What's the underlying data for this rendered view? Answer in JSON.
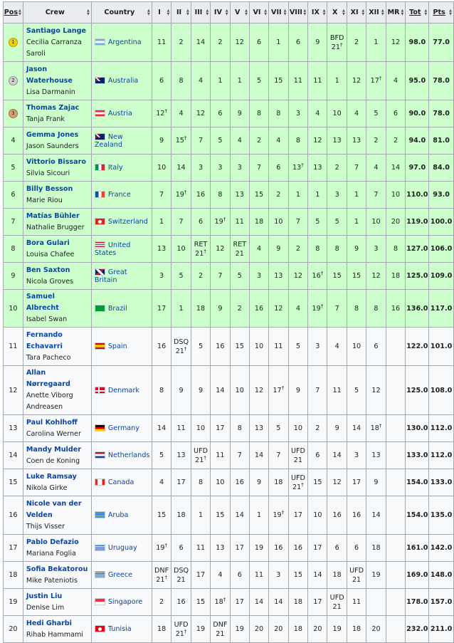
{
  "headers": {
    "pos": "Pos",
    "crew": "Crew",
    "country": "Country",
    "races": [
      "I",
      "II",
      "III",
      "IV",
      "V",
      "VI",
      "VII",
      "VIII",
      "IX",
      "X",
      "XI",
      "XII",
      "MR"
    ],
    "tot": "Tot",
    "pts": "Pts",
    "sort_icon": "sort-arrows-icon"
  },
  "dagger": "†",
  "rows": [
    {
      "pos": "1",
      "medal": "gold",
      "green": true,
      "crew": [
        "Santiago Lange",
        "Cecilia Carranza Saroli"
      ],
      "country": "Argentina",
      "flag": "argentina",
      "races": [
        "11",
        "2",
        "14",
        "2",
        "12",
        "6",
        "1",
        "6",
        "9",
        "BFD 21†",
        "2",
        "1",
        "12"
      ],
      "tot": "98.0",
      "pts": "77.0"
    },
    {
      "pos": "2",
      "medal": "silver",
      "green": true,
      "crew": [
        "Jason Waterhouse",
        "Lisa Darmanin"
      ],
      "country": "Australia",
      "flag": "australia",
      "races": [
        "6",
        "8",
        "4",
        "1",
        "1",
        "5",
        "15",
        "11",
        "11",
        "1",
        "12",
        "17†",
        "4"
      ],
      "tot": "95.0",
      "pts": "78.0"
    },
    {
      "pos": "3",
      "medal": "bronze",
      "green": true,
      "crew": [
        "Thomas Zajac",
        "Tanja Frank"
      ],
      "country": "Austria",
      "flag": "austria",
      "races": [
        "12†",
        "4",
        "12",
        "6",
        "9",
        "8",
        "8",
        "3",
        "4",
        "10",
        "4",
        "5",
        "6"
      ],
      "tot": "90.0",
      "pts": "78.0"
    },
    {
      "pos": "4",
      "medal": "",
      "green": true,
      "crew": [
        "Gemma Jones",
        "Jason Saunders"
      ],
      "country": "New Zealand",
      "flag": "newzealand",
      "races": [
        "9",
        "15†",
        "7",
        "5",
        "4",
        "2",
        "4",
        "8",
        "12",
        "13",
        "13",
        "2",
        "2"
      ],
      "tot": "94.0",
      "pts": "81.0"
    },
    {
      "pos": "5",
      "medal": "",
      "green": true,
      "crew": [
        "Vittorio Bissaro",
        "Silvia Sicouri"
      ],
      "country": "Italy",
      "flag": "italy",
      "races": [
        "10",
        "14",
        "3",
        "3",
        "3",
        "7",
        "6",
        "13†",
        "13",
        "2",
        "7",
        "4",
        "14"
      ],
      "tot": "97.0",
      "pts": "84.0"
    },
    {
      "pos": "6",
      "medal": "",
      "green": true,
      "crew": [
        "Billy Besson",
        "Marie Riou"
      ],
      "country": "France",
      "flag": "france",
      "races": [
        "7",
        "19†",
        "16",
        "8",
        "13",
        "15",
        "2",
        "1",
        "1",
        "3",
        "1",
        "7",
        "10"
      ],
      "tot": "110.0",
      "pts": "93.0"
    },
    {
      "pos": "7",
      "medal": "",
      "green": true,
      "crew": [
        "Matías Bühler",
        "Nathalie Brugger"
      ],
      "country": "Switzerland",
      "flag": "switzerland",
      "races": [
        "1",
        "7",
        "6",
        "19†",
        "11",
        "18",
        "10",
        "7",
        "5",
        "5",
        "1",
        "10",
        "20"
      ],
      "tot": "119.0",
      "pts": "100.0"
    },
    {
      "pos": "8",
      "medal": "",
      "green": true,
      "crew": [
        "Bora Gulari",
        "Louisa Chafee"
      ],
      "country": "United States",
      "flag": "usa",
      "races": [
        "13",
        "10",
        "RET 21†",
        "12",
        "RET 21",
        "4",
        "9",
        "2",
        "8",
        "8",
        "9",
        "3",
        "8"
      ],
      "tot": "127.0",
      "pts": "106.0"
    },
    {
      "pos": "9",
      "medal": "",
      "green": true,
      "crew": [
        "Ben Saxton",
        "Nicola Groves"
      ],
      "country": "Great Britain",
      "flag": "uk",
      "races": [
        "3",
        "5",
        "2",
        "7",
        "5",
        "3",
        "13",
        "12",
        "16†",
        "15",
        "15",
        "12",
        "18"
      ],
      "tot": "125.0",
      "pts": "109.0"
    },
    {
      "pos": "10",
      "medal": "",
      "green": true,
      "crew": [
        "Samuel Albrecht",
        "Isabel Swan"
      ],
      "country": "Brazil",
      "flag": "brazil",
      "races": [
        "17",
        "1",
        "18",
        "9",
        "2",
        "16",
        "12",
        "4",
        "19†",
        "7",
        "8",
        "8",
        "16"
      ],
      "tot": "136.0",
      "pts": "117.0"
    },
    {
      "pos": "11",
      "medal": "",
      "green": false,
      "crew": [
        "Fernando Echavarri",
        "Tara Pacheco"
      ],
      "country": "Spain",
      "flag": "spain",
      "races": [
        "16",
        "DSQ 21†",
        "5",
        "16",
        "15",
        "10",
        "11",
        "5",
        "3",
        "4",
        "10",
        "6",
        ""
      ],
      "tot": "122.0",
      "pts": "101.0"
    },
    {
      "pos": "12",
      "medal": "",
      "green": false,
      "crew": [
        "Allan Nørregaard",
        "Anette Viborg Andreasen"
      ],
      "country": "Denmark",
      "flag": "denmark",
      "races": [
        "8",
        "9",
        "9",
        "14",
        "10",
        "12",
        "17†",
        "9",
        "7",
        "11",
        "5",
        "12",
        ""
      ],
      "tot": "125.0",
      "pts": "108.0"
    },
    {
      "pos": "13",
      "medal": "",
      "green": false,
      "crew": [
        "Paul Kohlhoff",
        "Carolina Werner"
      ],
      "country": "Germany",
      "flag": "germany",
      "races": [
        "14",
        "11",
        "10",
        "17",
        "8",
        "13",
        "5",
        "10",
        "2",
        "9",
        "14",
        "18†",
        ""
      ],
      "tot": "130.0",
      "pts": "112.0"
    },
    {
      "pos": "14",
      "medal": "",
      "green": false,
      "crew": [
        "Mandy Mulder",
        "Coen de Koning"
      ],
      "country": "Netherlands",
      "flag": "netherlands",
      "races": [
        "5",
        "13",
        "UFD 21†",
        "11",
        "7",
        "14",
        "7",
        "UFD 21",
        "6",
        "14",
        "3",
        "13",
        ""
      ],
      "tot": "133.0",
      "pts": "112.0"
    },
    {
      "pos": "15",
      "medal": "",
      "green": false,
      "crew": [
        "Luke Ramsay",
        "Nikola Girke"
      ],
      "country": "Canada",
      "flag": "canada",
      "races": [
        "4",
        "17",
        "8",
        "10",
        "16",
        "9",
        "18",
        "UFD 21†",
        "15",
        "12",
        "17",
        "9",
        ""
      ],
      "tot": "154.0",
      "pts": "133.0"
    },
    {
      "pos": "16",
      "medal": "",
      "green": false,
      "crew": [
        "Nicole van der Velden",
        "Thijs Visser"
      ],
      "country": "Aruba",
      "flag": "aruba",
      "races": [
        "15",
        "18",
        "1",
        "15",
        "14",
        "1",
        "19†",
        "17",
        "10",
        "16",
        "16",
        "14",
        ""
      ],
      "tot": "154.0",
      "pts": "135.0"
    },
    {
      "pos": "17",
      "medal": "",
      "green": false,
      "crew": [
        "Pablo Defazio",
        "Mariana Foglia"
      ],
      "country": "Uruguay",
      "flag": "uruguay",
      "races": [
        "19†",
        "6",
        "11",
        "13",
        "17",
        "19",
        "16",
        "16",
        "17",
        "6",
        "6",
        "18",
        ""
      ],
      "tot": "161.0",
      "pts": "142.0"
    },
    {
      "pos": "18",
      "medal": "",
      "green": false,
      "crew": [
        "Sofia Bekatorou",
        "Mike Pateniotis"
      ],
      "country": "Greece",
      "flag": "greece",
      "races": [
        "DNF 21†",
        "DSQ 21",
        "17",
        "4",
        "6",
        "11",
        "3",
        "15",
        "14",
        "18",
        "UFD 21",
        "19",
        ""
      ],
      "tot": "169.0",
      "pts": "148.0"
    },
    {
      "pos": "19",
      "medal": "",
      "green": false,
      "crew": [
        "Justin Liu",
        "Denise Lim"
      ],
      "country": "Singapore",
      "flag": "singapore",
      "races": [
        "2",
        "16",
        "15",
        "18†",
        "17",
        "14",
        "14",
        "18",
        "17",
        "UFD 21",
        "11",
        ""
      ],
      "tot": "178.0",
      "pts": "157.0"
    },
    {
      "pos": "20",
      "medal": "",
      "green": false,
      "crew": [
        "Hedi Gharbi",
        "Rihab Hammami"
      ],
      "country": "Tunisia",
      "flag": "tunisia",
      "races": [
        "18",
        "UFD 21†",
        "19",
        "DNF 21",
        "19",
        "20",
        "20",
        "18",
        "20",
        "19",
        "18",
        "20",
        ""
      ],
      "tot": "232.0",
      "pts": "211.0"
    }
  ],
  "colors": {
    "green_row": "#ccffcc",
    "white_row": "#f8f9fa",
    "header": "#eaecf0",
    "link": "#0645ad",
    "border": "#a2a9b1"
  }
}
